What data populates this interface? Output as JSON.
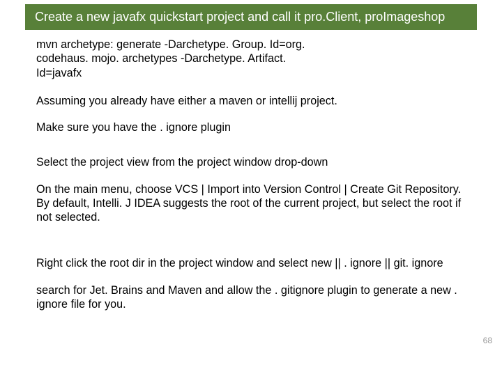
{
  "title": "Create a new javafx quickstart project and call it pro.Client, proImageshop",
  "paragraphs": {
    "p1": "mvn archetype: generate -Darchetype. Group. Id=org. codehaus. mojo. archetypes -Darchetype. Artifact. Id=javafx",
    "p2": "Assuming you already have either a maven or intellij project.",
    "p3": "Make sure you have the . ignore plugin",
    "p4": "Select the project view from the project window drop-down",
    "p5": "On the main menu, choose VCS | Import into Version Control | Create Git Repository.\nBy default, Intelli. J IDEA suggests the root of the current project, but select the root if not selected.",
    "p6": "Right click the root dir in the project window and select new || . ignore || git. ignore",
    "p7": "search for Jet. Brains and Maven and allow the . gitignore plugin to generate a new . ignore file for you."
  },
  "page_number": "68"
}
